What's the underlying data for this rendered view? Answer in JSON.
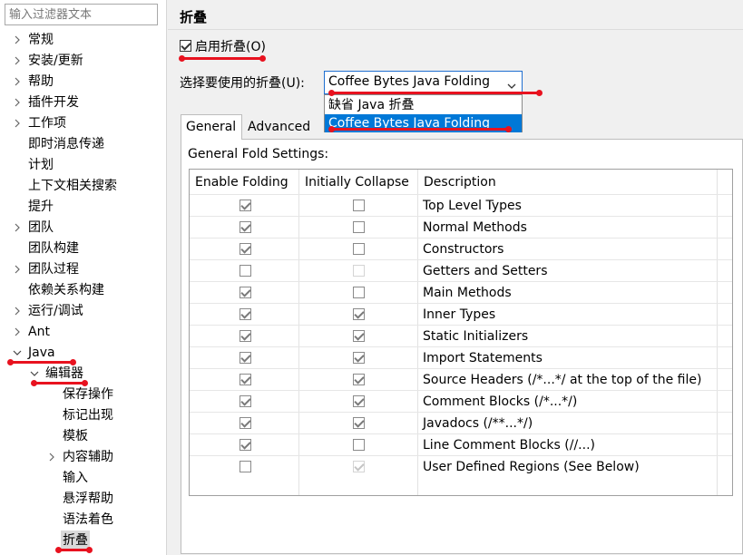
{
  "sidebar": {
    "filter_placeholder": "输入过滤器文本",
    "items": [
      {
        "label": "常规"
      },
      {
        "label": "安装/更新"
      },
      {
        "label": "帮助"
      },
      {
        "label": "插件开发"
      },
      {
        "label": "工作项"
      },
      {
        "label": "即时消息传递"
      },
      {
        "label": "计划"
      },
      {
        "label": "上下文相关搜索"
      },
      {
        "label": "提升"
      },
      {
        "label": "团队"
      },
      {
        "label": "团队构建"
      },
      {
        "label": "团队过程"
      },
      {
        "label": "依赖关系构建"
      },
      {
        "label": "运行/调试"
      },
      {
        "label": "Ant"
      },
      {
        "label": "Java"
      },
      {
        "label": "编辑器"
      },
      {
        "label": "保存操作"
      },
      {
        "label": "标记出现"
      },
      {
        "label": "模板"
      },
      {
        "label": "内容辅助"
      },
      {
        "label": "输入"
      },
      {
        "label": "悬浮帮助"
      },
      {
        "label": "语法着色"
      },
      {
        "label": "折叠"
      }
    ]
  },
  "page": {
    "title": "折叠",
    "enable_label": "启用折叠(O)",
    "enable_checked": true,
    "select_label": "选择要使用的折叠(U):",
    "combo_value": "Coffee Bytes Java Folding",
    "dropdown_options": [
      "缺省 Java 折叠",
      "Coffee Bytes Java Folding"
    ],
    "dropdown_highlighted": "Coffee Bytes Java Folding"
  },
  "tabs": [
    {
      "label": "General",
      "active": true
    },
    {
      "label": "Advanced",
      "active": false
    }
  ],
  "general": {
    "settings_label": "General Fold Settings:",
    "headers": [
      "Enable Folding",
      "Initially Collapse",
      "Description"
    ],
    "rows": [
      {
        "enable": true,
        "collapse": false,
        "desc": "Top Level Types"
      },
      {
        "enable": true,
        "collapse": false,
        "desc": "Normal Methods"
      },
      {
        "enable": true,
        "collapse": false,
        "desc": "Constructors"
      },
      {
        "enable": false,
        "collapse": false,
        "desc": "Getters and Setters"
      },
      {
        "enable": true,
        "collapse": false,
        "desc": "Main Methods"
      },
      {
        "enable": true,
        "collapse": true,
        "desc": "Inner Types"
      },
      {
        "enable": true,
        "collapse": true,
        "desc": "Static Initializers"
      },
      {
        "enable": true,
        "collapse": true,
        "desc": "Import Statements"
      },
      {
        "enable": true,
        "collapse": true,
        "desc": "Source Headers (/*...*/ at the top of the file)"
      },
      {
        "enable": true,
        "collapse": true,
        "desc": "Comment Blocks (/*...*/)"
      },
      {
        "enable": true,
        "collapse": true,
        "desc": "Javadocs (/**...*/)"
      },
      {
        "enable": true,
        "collapse": false,
        "desc": "Line Comment Blocks (//...)"
      },
      {
        "enable": false,
        "collapse": true,
        "desc": "User Defined Regions (See Below)"
      }
    ]
  },
  "colors": {
    "accent": "#1f6fd0",
    "highlight": "#0078d7",
    "annotation": "#e8121f",
    "selected_tree_bg": "#d9d9d9"
  }
}
